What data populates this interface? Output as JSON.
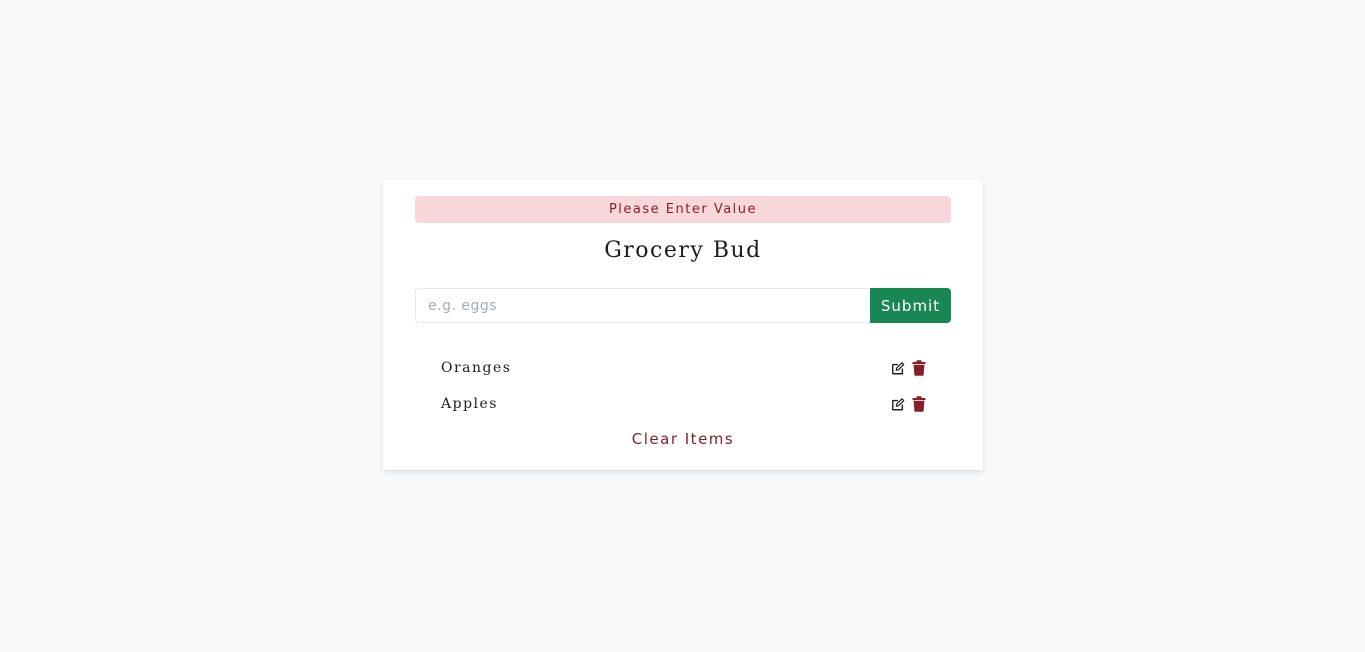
{
  "alert": {
    "text": "Please Enter Value",
    "background": "#f8d7da",
    "color": "#842029"
  },
  "header": {
    "title": "Grocery Bud"
  },
  "form": {
    "input_value": "",
    "input_placeholder": "e.g. eggs",
    "submit_label": "Submit",
    "submit_color": "#198754"
  },
  "items": [
    {
      "name": "Oranges",
      "edit_icon": "edit-icon",
      "delete_icon": "trash-icon"
    },
    {
      "name": "Apples",
      "edit_icon": "edit-icon",
      "delete_icon": "trash-icon"
    }
  ],
  "footer": {
    "clear_label": "Clear Items",
    "clear_color": "#842029"
  }
}
